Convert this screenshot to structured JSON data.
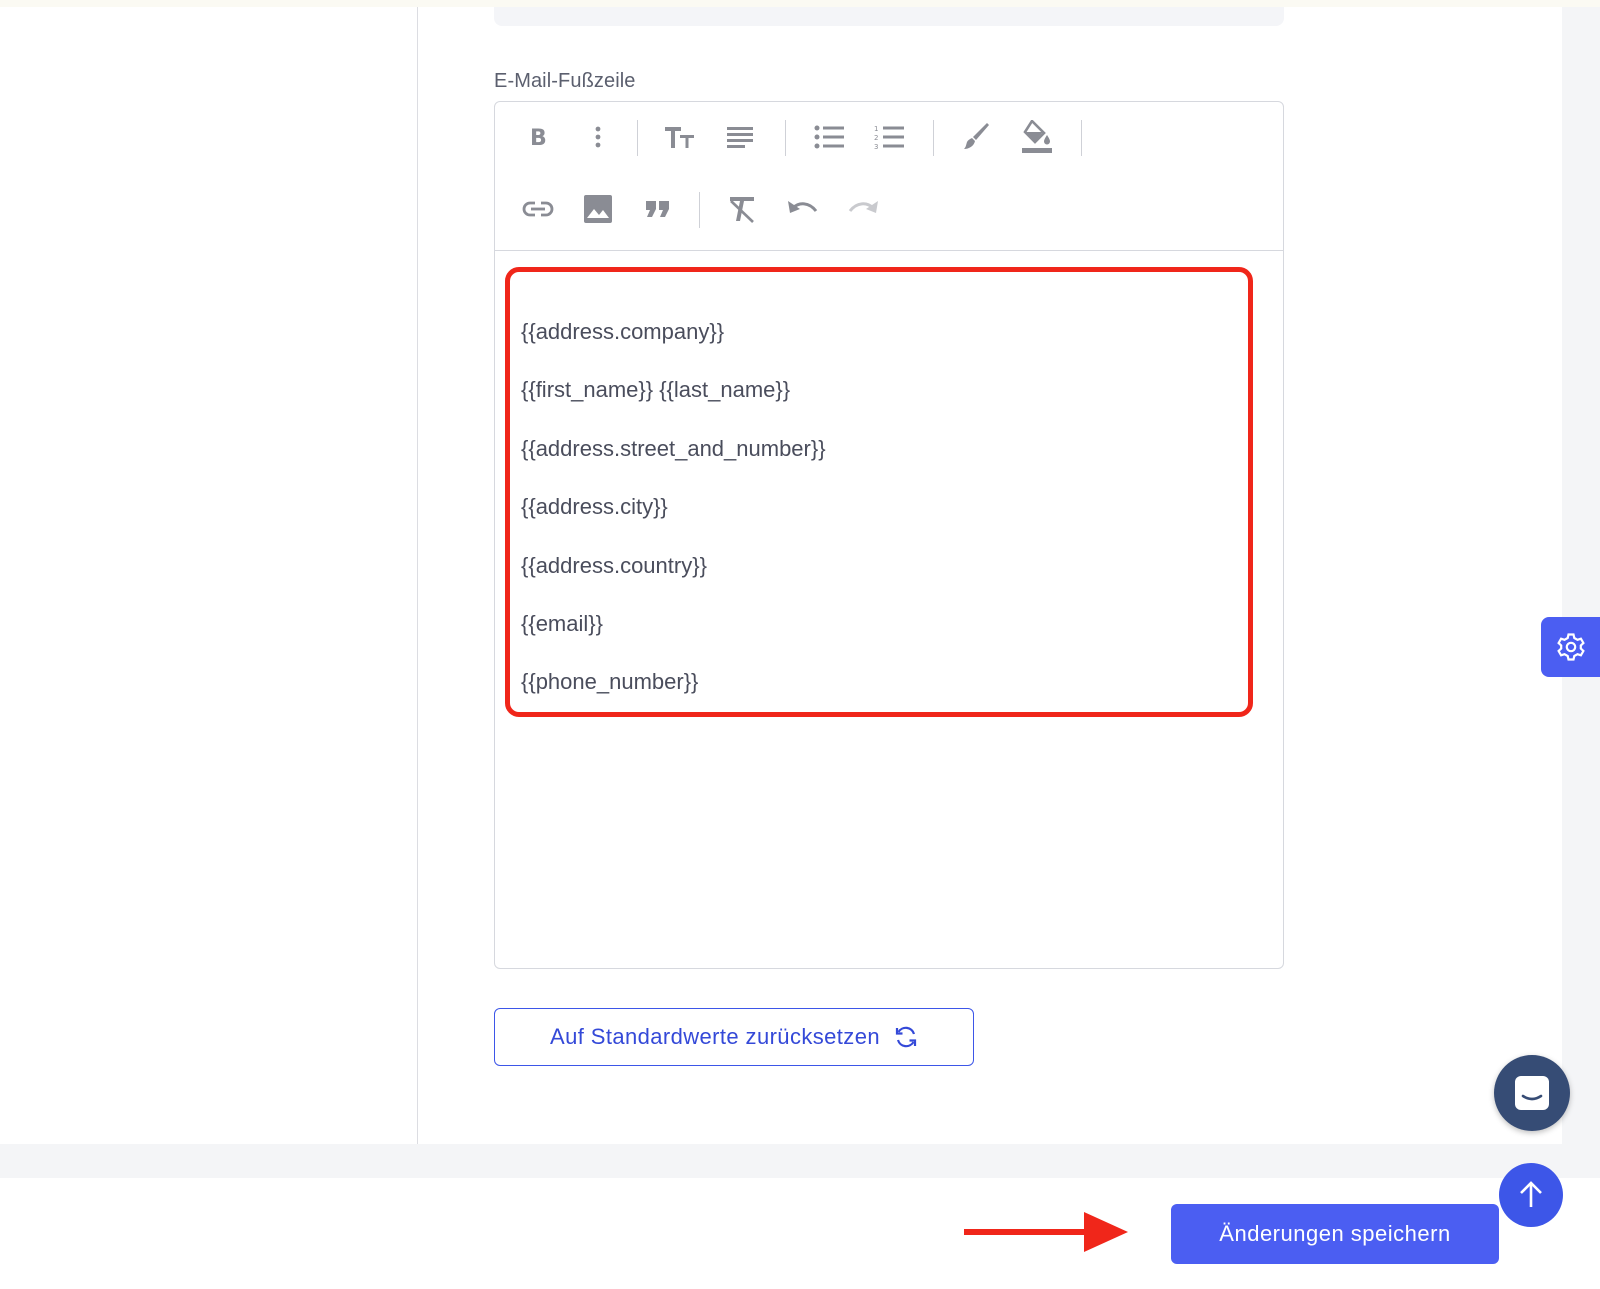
{
  "editor": {
    "label": "E-Mail-Fußzeile",
    "toolbar": {
      "row1": [
        "bold-icon",
        "more-vertical-icon",
        "text-size-icon",
        "align-icon",
        "bulleted-list-icon",
        "numbered-list-icon",
        "brush-icon",
        "fill-color-icon"
      ],
      "row2": [
        "link-icon",
        "image-icon",
        "quote-icon",
        "clear-format-icon",
        "undo-icon",
        "redo-icon"
      ]
    },
    "lines": [
      "{{address.company}}",
      "{{first_name}} {{last_name}}",
      "{{address.street_and_number}}",
      "{{address.city}}",
      "{{address.country}}",
      "{{email}}",
      "{{phone_number}}"
    ]
  },
  "actions": {
    "reset_label": "Auf Standardwerte zurücksetzen",
    "save_label": "Änderungen speichern"
  },
  "floating": {
    "settings_icon": "gear-icon",
    "chat_icon": "chat-icon",
    "scroll_top_icon": "arrow-up-icon"
  },
  "colors": {
    "accent": "#4b5ef2",
    "highlight": "#f0261a",
    "chat": "#364c75"
  }
}
